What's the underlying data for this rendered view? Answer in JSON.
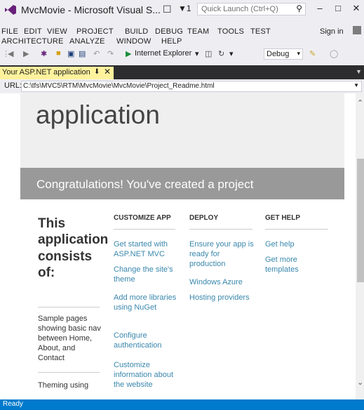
{
  "window": {
    "title": "MvcMovie - Microsoft Visual S...",
    "notification_count": "1",
    "quick_launch_placeholder": "Quick Launch (Ctrl+Q)",
    "min_label": "–",
    "max_label": "□",
    "close_label": "✕"
  },
  "menu": {
    "row1": [
      "FILE",
      "EDIT",
      "VIEW",
      "PROJECT",
      "BUILD",
      "DEBUG",
      "TEAM",
      "TOOLS",
      "TEST"
    ],
    "row2": [
      "ARCHITECTURE",
      "ANALYZE",
      "WINDOW",
      "HELP"
    ],
    "sign_in": "Sign in"
  },
  "toolbar": {
    "browser_label": "Internet Explorer",
    "config_value": "Debug"
  },
  "tabs": [
    {
      "label": "Your ASP.NET application",
      "active": true
    }
  ],
  "urlbar": {
    "label": "URL:",
    "value": "C:\\tfs\\MVC5\\RTM\\MvcMovie\\MvcMovie\\Project_Readme.html"
  },
  "page": {
    "hero_title": "application",
    "banner": "Congratulations! You've created a project",
    "left_heading": [
      "This",
      "application",
      "consists",
      "of:"
    ],
    "left_items": [
      "Sample pages showing basic nav between Home, About, and Contact",
      "Theming using"
    ],
    "columns": [
      {
        "heading": "CUSTOMIZE APP",
        "links": [
          "Get started with ASP.NET MVC",
          "Change the site's theme",
          "Add more libraries using NuGet",
          "Configure authentication",
          "Customize information about the website"
        ]
      },
      {
        "heading": "DEPLOY",
        "links": [
          "Ensure your app is ready for production",
          "Windows Azure",
          "Hosting providers"
        ]
      },
      {
        "heading": "GET HELP",
        "links": [
          "Get help",
          "Get more templates"
        ]
      }
    ]
  },
  "status": {
    "text": "Ready"
  },
  "colors": {
    "accent": "#007acc",
    "active_tab": "#fff29d",
    "link": "#3a87ad",
    "banner": "#999999"
  }
}
